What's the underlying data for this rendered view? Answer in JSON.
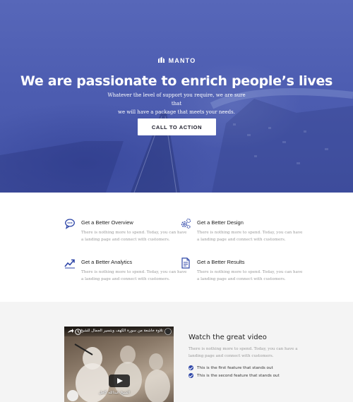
{
  "hero": {
    "brand": "MANTO",
    "title": "We are passionate to enrich people’s lives",
    "subtitle_line1": "Whatever the level of support you require, we are sure that",
    "subtitle_line2": "we will have a package that meets your needs.",
    "cta_label": "CALL TO ACTION"
  },
  "features": [
    {
      "icon": "chat-bubble-icon",
      "title": "Get a Better Overview",
      "desc": "There is nothing more to spend. Today, you can have a landing page and connect with customers."
    },
    {
      "icon": "gears-icon",
      "title": "Get a Better Design",
      "desc": "There is nothing more to spend. Today, you can have a landing page and connect with customers."
    },
    {
      "icon": "trend-chart-icon",
      "title": "Get a Better Analytics",
      "desc": "There is nothing more to spend. Today, you can have a landing page and connect with customers."
    },
    {
      "icon": "document-icon",
      "title": "Get a Better Results",
      "desc": "There is nothing more to spend. Today, you can have a landing page and connect with customers."
    }
  ],
  "video_section": {
    "video_title": "تلاوة خاشعة من سورة الكهف وبتسير الجمال للشيخ عبدالله كامل",
    "video_caption": "الشيخ عبدالله كامل",
    "title": "Watch the great video",
    "desc": "There is nothing more to spend. Today, you can have a landing page and connect with customers.",
    "checks": [
      "This is the first feature that stands out",
      "This is the second feature that stands out"
    ]
  },
  "colors": {
    "hero_overlay": "#4d5db1",
    "accent": "#2f47a8",
    "section_bg": "#f4f4f4"
  }
}
